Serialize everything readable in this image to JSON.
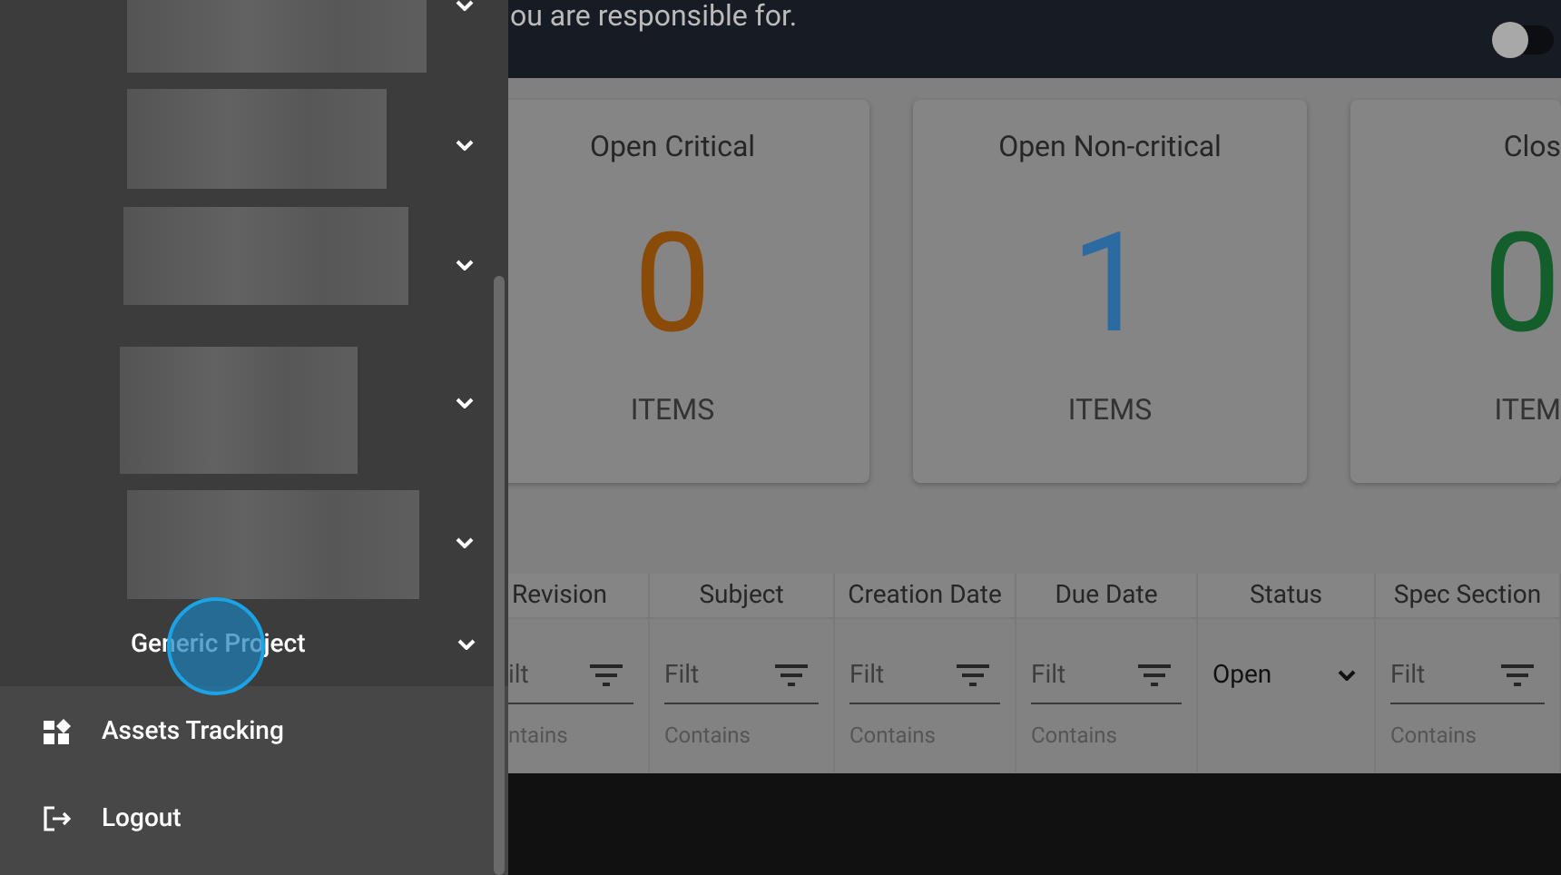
{
  "header": {
    "text": "ou are responsible for.",
    "toggle": {
      "on": false
    }
  },
  "cards": [
    {
      "title": "Open Critical",
      "value": "0",
      "unit": "ITEMS",
      "color": "#8a4a08"
    },
    {
      "title": "Open Non-critical",
      "value": "1",
      "unit": "ITEMS",
      "color": "#2c6aa2"
    },
    {
      "title": "Clos",
      "value": "0",
      "unit": "ITEM",
      "color": "#145e2c"
    }
  ],
  "table": {
    "columns": [
      {
        "label": "Revision",
        "filter": {
          "kind": "text",
          "placeholder": "ilt",
          "mode": "ntains"
        }
      },
      {
        "label": "Subject",
        "filter": {
          "kind": "text",
          "placeholder": "Filt",
          "mode": "Contains"
        }
      },
      {
        "label": "Creation Date",
        "filter": {
          "kind": "text",
          "placeholder": "Filt",
          "mode": "Contains"
        }
      },
      {
        "label": "Due Date",
        "filter": {
          "kind": "text",
          "placeholder": "Filt",
          "mode": "Contains"
        }
      },
      {
        "label": "Status",
        "filter": {
          "kind": "select",
          "value": "Open"
        }
      },
      {
        "label": "Spec Section",
        "filter": {
          "kind": "text",
          "placeholder": "Filt",
          "mode": "Contains"
        }
      }
    ]
  },
  "sidebar": {
    "items": [
      {
        "kind": "blurred",
        "expanded": false
      },
      {
        "kind": "blurred",
        "expanded": false
      },
      {
        "kind": "blurred",
        "expanded": false
      },
      {
        "kind": "blurred",
        "expanded": false
      },
      {
        "kind": "blurred",
        "expanded": false
      },
      {
        "kind": "project",
        "label": "Generic Project",
        "expanded": false,
        "clicked": true
      }
    ],
    "links": [
      {
        "kind": "assets",
        "label": "Assets Tracking"
      },
      {
        "kind": "logout",
        "label": "Logout"
      }
    ]
  }
}
